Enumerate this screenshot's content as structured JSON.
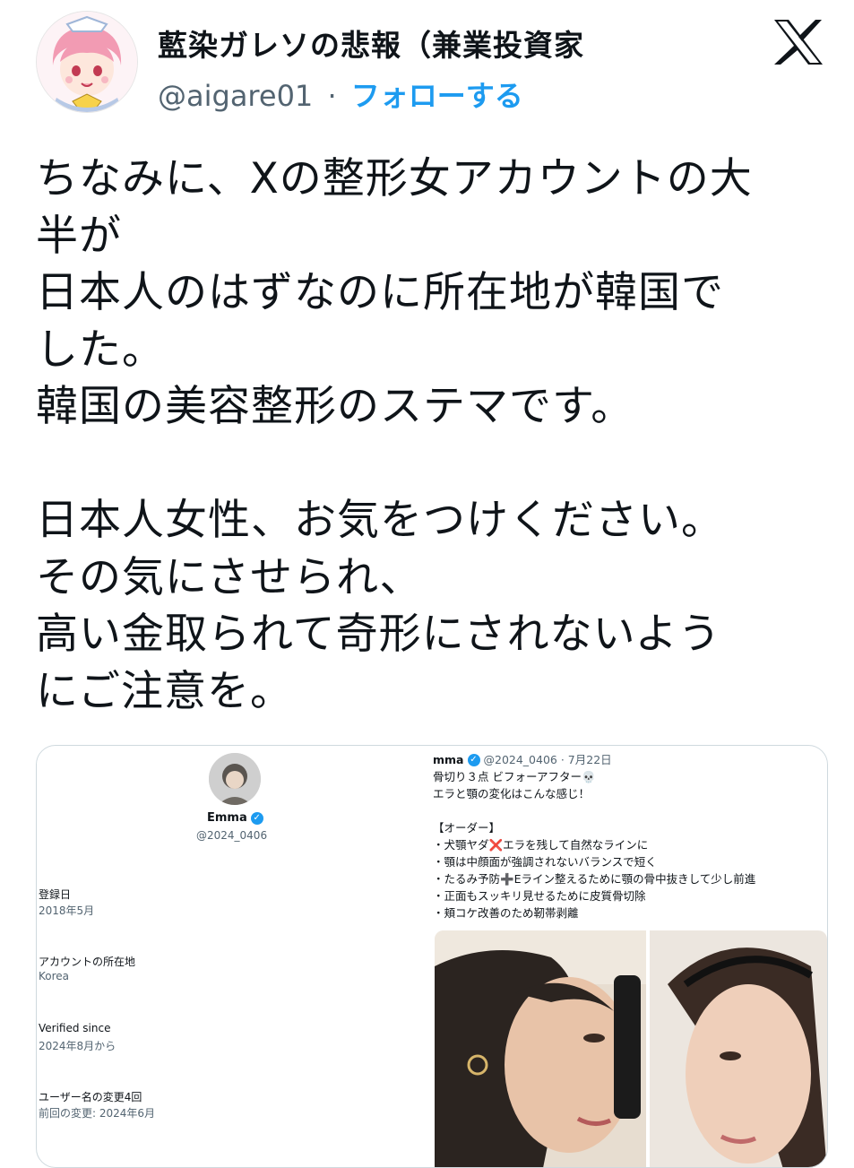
{
  "author": {
    "display_name": "藍染ガレソの悲報（兼業投資家",
    "handle": "@aigare01",
    "separator": "·",
    "follow_label": "フォローする",
    "avatar_icon": "anime-girl-avatar-icon"
  },
  "logo_icon": "x-logo-icon",
  "tweet": {
    "text": "ちなみに、Xの整形女アカウントの大\n半が\n日本人のはずなのに所在地が韓国で\nした。\n韓国の美容整形のステマです。\n\n日本人女性、お気をつけください。\nその気にさせられ、\n高い金取られて奇形にされないよう\nにご注意を。"
  },
  "embedded": {
    "profile": {
      "name": "Emma",
      "handle": "@2024_0406",
      "registered_label": "登録日",
      "registered_value": "2018年5月",
      "location_label": "アカウントの所在地",
      "location_value": "Korea",
      "verified_label": "Verified since",
      "verified_value": "2024年8月から",
      "username_label": "ユーザー名の変更4回",
      "username_value": "前回の変更: 2024年6月"
    },
    "post": {
      "name": "mma",
      "handle_date": "@2024_0406 · 7月22日",
      "line1": "骨切り３点 ビフォーアフター💀",
      "line2": "エラと顎の変化はこんな感じ！",
      "order_header": "【オーダー】",
      "items": [
        "・犬顎ヤダ❌エラを残して自然なラインに",
        "・顎は中顔面が強調されないバランスで短く",
        "・たるみ予防➕Eライン整えるために顎の骨中抜きして少し前進",
        "・正面もスッキリ見せるために皮質骨切除",
        "・頬コケ改善のため靭帯剥離"
      ]
    }
  },
  "colors": {
    "accent": "#1d9bf0",
    "secondary_text": "#536471",
    "border": "#cfd9de"
  }
}
